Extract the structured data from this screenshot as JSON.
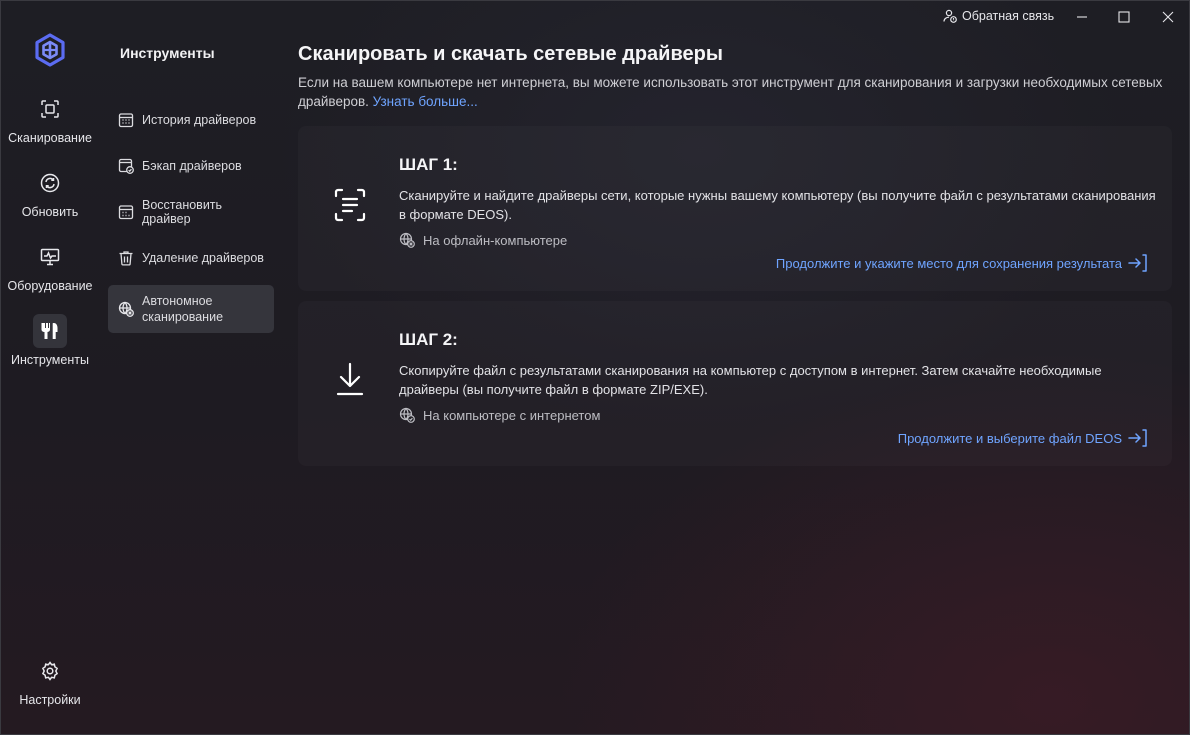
{
  "titlebar": {
    "feedback_label": "Обратная связь"
  },
  "rail": {
    "items": [
      {
        "label": "Сканирование",
        "icon": "scan-icon"
      },
      {
        "label": "Обновить",
        "icon": "refresh-icon"
      },
      {
        "label": "Оборудование",
        "icon": "monitor-icon"
      },
      {
        "label": "Инструменты",
        "icon": "tools-icon",
        "active": true
      }
    ],
    "settings_label": "Настройки"
  },
  "subnav": {
    "title": "Инструменты",
    "items": [
      {
        "label": "История драйверов",
        "icon": "calendar-icon"
      },
      {
        "label": "Бэкап драйверов",
        "icon": "backup-icon"
      },
      {
        "label": "Восстановить драйвер",
        "icon": "restore-icon"
      },
      {
        "label": "Удаление драйверов",
        "icon": "trash-icon"
      },
      {
        "label_line1": "Автономное",
        "label_line2": "сканирование",
        "icon": "offline-globe-icon",
        "active": true
      }
    ]
  },
  "main": {
    "title": "Сканировать и скачать сетевые драйверы",
    "description": "Если на вашем компьютере нет интернета, вы можете использовать этот инструмент для сканирования и загрузки необходимых сетевых драйверов.",
    "learn_more": "Узнать больше...",
    "steps": [
      {
        "title": "ШАГ 1:",
        "description": "Сканируйте и найдите драйверы сети, которые нужны вашему компьютеру (вы получите файл с результатами сканирования в формате DEOS).",
        "where": "На офлайн-компьютере",
        "link": "Продолжите и укажите место для сохранения результата"
      },
      {
        "title": "ШАГ 2:",
        "description": "Скопируйте файл с результатами сканирования на компьютер с доступом в интернет. Затем скачайте необходимые драйверы (вы получите файл в формате ZIP/EXE).",
        "where": "На компьютере с интернетом",
        "link": "Продолжите и выберите файл DEOS"
      }
    ]
  },
  "colors": {
    "accent": "#6fa4ff",
    "logo": "#5b6cf2"
  }
}
